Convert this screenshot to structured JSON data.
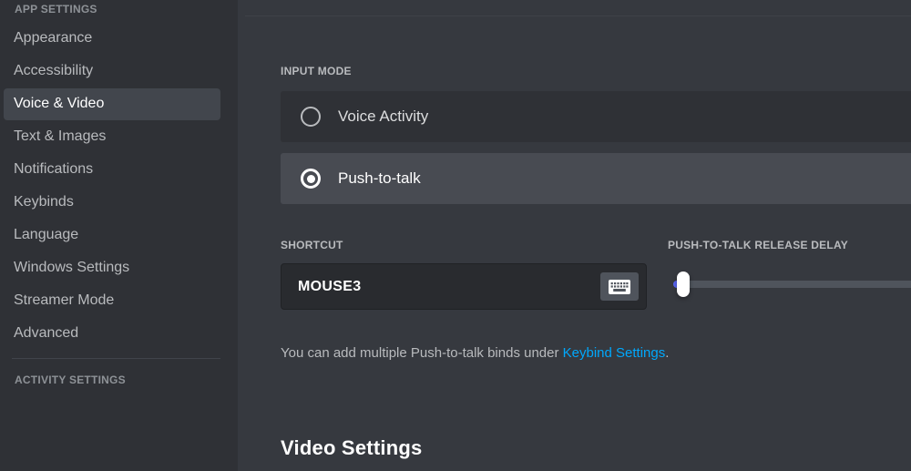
{
  "sidebar": {
    "app_settings_header": "APP SETTINGS",
    "items": [
      {
        "label": "Appearance",
        "active": false
      },
      {
        "label": "Accessibility",
        "active": false
      },
      {
        "label": "Voice & Video",
        "active": true
      },
      {
        "label": "Text & Images",
        "active": false
      },
      {
        "label": "Notifications",
        "active": false
      },
      {
        "label": "Keybinds",
        "active": false
      },
      {
        "label": "Language",
        "active": false
      },
      {
        "label": "Windows Settings",
        "active": false
      },
      {
        "label": "Streamer Mode",
        "active": false
      },
      {
        "label": "Advanced",
        "active": false
      }
    ],
    "activity_settings_header": "ACTIVITY SETTINGS"
  },
  "main": {
    "input_mode": {
      "label": "INPUT MODE",
      "options": [
        {
          "label": "Voice Activity",
          "selected": false
        },
        {
          "label": "Push-to-talk",
          "selected": true
        }
      ]
    },
    "shortcut": {
      "label": "SHORTCUT",
      "value": "MOUSE3",
      "record_icon": "keyboard-icon"
    },
    "release_delay": {
      "label": "PUSH-TO-TALK RELEASE DELAY",
      "value_percent": 2
    },
    "helper": {
      "text_before": "You can add multiple Push-to-talk binds under ",
      "link_text": "Keybind Settings",
      "text_after": "."
    },
    "video_settings_heading": "Video Settings"
  },
  "colors": {
    "sidebar_bg": "#2f3136",
    "content_bg": "#36393f",
    "active_item_bg": "#42464d",
    "row_unselected_bg": "#2f3136",
    "row_selected_bg": "#484b52",
    "accent_blurple": "#5865f2",
    "link_blue": "#00a8fc",
    "text_muted": "#b9bbbe",
    "text_bright": "#ffffff"
  }
}
